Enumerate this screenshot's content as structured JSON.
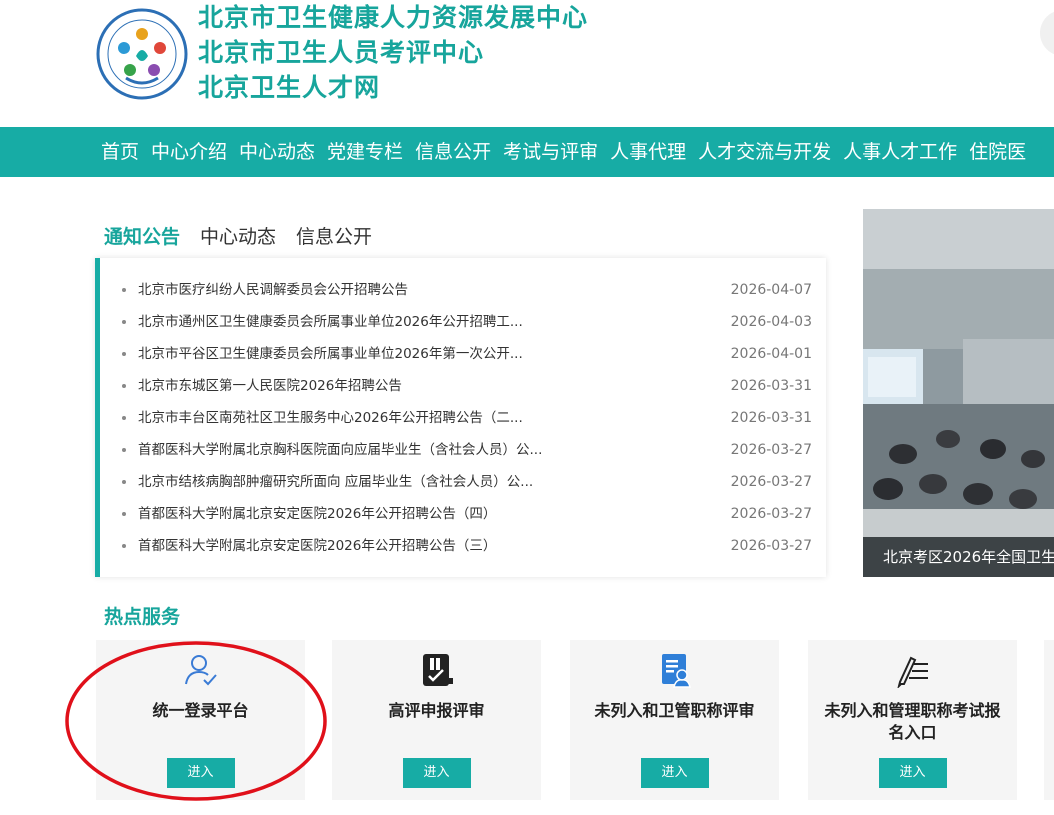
{
  "header": {
    "titles": [
      "北京市卫生健康人力资源发展中心",
      "北京市卫生人员考评中心",
      "北京卫生人才网"
    ],
    "logo_icon": "center-logo-icon"
  },
  "nav": {
    "items": [
      "首页",
      "中心介绍",
      "中心动态",
      "党建专栏",
      "信息公开",
      "考试与评审",
      "人事代理",
      "人才交流与开发",
      "人事人才工作",
      "住院医"
    ]
  },
  "tabs": [
    "通知公告",
    "中心动态",
    "信息公开"
  ],
  "news": [
    {
      "title": "北京市医疗纠纷人民调解委员会公开招聘公告",
      "date": "2026-04-07"
    },
    {
      "title": "北京市通州区卫生健康委员会所属事业单位2026年公开招聘工...",
      "date": "2026-04-03"
    },
    {
      "title": "北京市平谷区卫生健康委员会所属事业单位2026年第一次公开...",
      "date": "2026-04-01"
    },
    {
      "title": "北京市东城区第一人民医院2026年招聘公告",
      "date": "2026-03-31"
    },
    {
      "title": "北京市丰台区南苑社区卫生服务中心2026年公开招聘公告（二...",
      "date": "2026-03-31"
    },
    {
      "title": "首都医科大学附属北京胸科医院面向应届毕业生（含社会人员）公...",
      "date": "2026-03-27"
    },
    {
      "title": "北京市结核病胸部肿瘤研究所面向 应届毕业生（含社会人员）公...",
      "date": "2026-03-27"
    },
    {
      "title": "首都医科大学附属北京安定医院2026年公开招聘公告（四）",
      "date": "2026-03-27"
    },
    {
      "title": "首都医科大学附属北京安定医院2026年公开招聘公告（三）",
      "date": "2026-03-27"
    }
  ],
  "photo": {
    "caption": "北京考区2026年全国卫生"
  },
  "hot": {
    "title": "热点服务",
    "cards": [
      {
        "label": "统一登录平台",
        "button": "进入",
        "icon": "user-check-icon"
      },
      {
        "label": "高评申报评审",
        "button": "进入",
        "icon": "document-stamp-icon"
      },
      {
        "label": "未列入和卫管职称评审",
        "button": "进入",
        "icon": "user-document-icon"
      },
      {
        "label": "未列入和管理职称考试报名入口",
        "button": "进入",
        "icon": "pen-list-icon"
      }
    ]
  },
  "colors": {
    "accent": "#17aca5",
    "annotation": "#e0101a"
  }
}
